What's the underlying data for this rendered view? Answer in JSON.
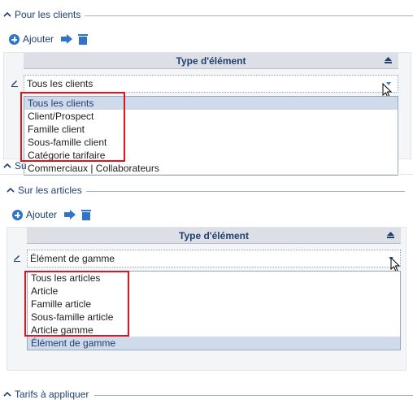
{
  "section_clients": {
    "title": "Pour les clients",
    "add_label": "Ajouter",
    "column_header": "Type d'élément",
    "selected_value": "Tous les clients",
    "options": [
      "Tous les clients",
      "Client/Prospect",
      "Famille client",
      "Sous-famille client",
      "Catégorie tarifaire",
      "Commerciaux | Collaborateurs"
    ],
    "highlighted_index": 0
  },
  "section_hidden_partial": "Su",
  "section_articles": {
    "title": "Sur les articles",
    "add_label": "Ajouter",
    "column_header": "Type d'élément",
    "selected_value": "Élément de gamme",
    "options": [
      "Tous les articles",
      "Article",
      "Famille article",
      "Sous-famille article",
      "Article gamme",
      "Élément de gamme"
    ],
    "highlighted_index": 5
  },
  "section_tarifs": {
    "title": "Tarifs à appliquer"
  },
  "colors": {
    "accent": "#2e74c9",
    "title_text": "#1f3f6f",
    "highlight_box": "#e0141b",
    "selected_row": "#cfdaea"
  },
  "icons": [
    "chevron-up-icon",
    "add-icon",
    "move-arrow-icon",
    "trash-icon",
    "edit-pencil-icon",
    "sort-up-icon",
    "dropdown-arrow-icon",
    "mouse-cursor-icon"
  ]
}
